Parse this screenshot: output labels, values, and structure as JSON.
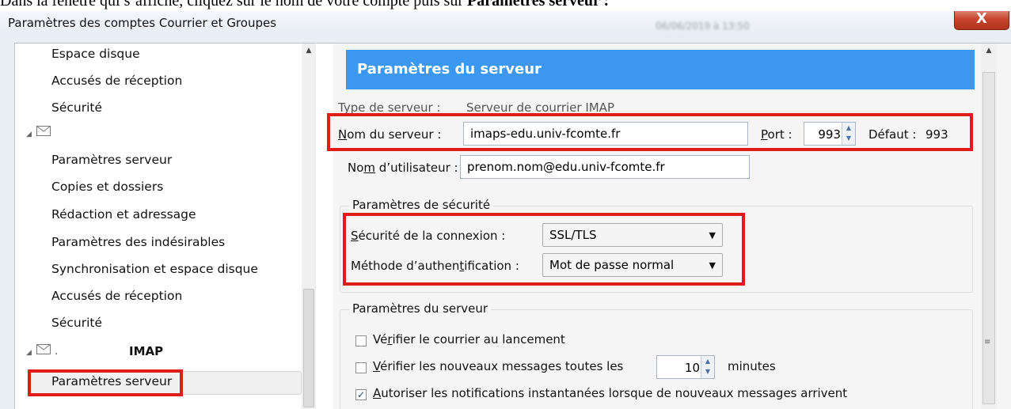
{
  "doc_line": {
    "prefix": "Dans la fenêtre qui s’affiche, cliquez sur le nom de votre compte puis sur ",
    "bold": "Paramètres serveur :"
  },
  "window": {
    "title": "Paramètres des comptes Courrier et Groupes",
    "date_blurred": "06/06/2019 à 13:50",
    "close_glyph": "X"
  },
  "tree": {
    "items_top": [
      "Espace disque",
      "Accusés de réception",
      "Sécurité"
    ],
    "account_collapse_glyph": "◢",
    "envelope_icon": "envelope-icon",
    "items_account": [
      "Paramètres serveur",
      "Copies et dossiers",
      "Rédaction et adressage",
      "Paramètres des indésirables",
      "Synchronisation et espace disque",
      "Accusés de réception",
      "Sécurité"
    ],
    "imap_account_label": "IMAP",
    "imap_account_dot": ".",
    "selected_item": "Paramètres serveur",
    "scroll_up_glyph": "▲"
  },
  "panel": {
    "header": "Paramètres du serveur",
    "server_type_label": "Type de serveur :",
    "server_type_value": "Serveur de courrier IMAP",
    "server_name": {
      "label_underlined": "N",
      "label_rest": "om du serveur :",
      "value": "imaps-edu.univ-fcomte.fr"
    },
    "port": {
      "label_underlined": "P",
      "label_rest": "ort :",
      "value": "993",
      "default_label": "Défaut :",
      "default_value": "993"
    },
    "username": {
      "label_before": "No",
      "label_underlined": "m",
      "label_rest": " d’utilisateur :",
      "value": "prenom.nom@edu.univ-fcomte.fr"
    },
    "security_group": {
      "title": "Paramètres de sécurité",
      "connection_label_underlined": "S",
      "connection_label_rest": "écurité de la connexion :",
      "connection_value": "SSL/TLS",
      "auth_label_before": "Méthode d’authen",
      "auth_label_underlined": "t",
      "auth_label_rest": "ification :",
      "auth_value": "Mot de passe normal"
    },
    "server_group": {
      "title": "Paramètres du serveur",
      "check_on_launch_before": "Vé",
      "check_on_launch_underlined": "r",
      "check_on_launch_rest": "ifier le courrier au lancement",
      "check_on_launch_checked": false,
      "check_every_underlined": "V",
      "check_every_rest": "érifier les nouveaux messages toutes les",
      "check_every_checked": false,
      "check_every_value": "10",
      "check_every_unit": "minutes",
      "push_underlined": "A",
      "push_rest": "utoriser les notifications instantanées lorsque de nouveaux messages arrivent",
      "push_checked": true,
      "check_glyph": "✓"
    },
    "spin_up_glyph": "▲",
    "spin_down_glyph": "▼",
    "dropdown_glyph": "▼",
    "grip_glyph": "≡"
  },
  "colors": {
    "header_blue": "#3c97f0",
    "highlight_red": "#e11a1a",
    "close_red": "#c7432b"
  }
}
